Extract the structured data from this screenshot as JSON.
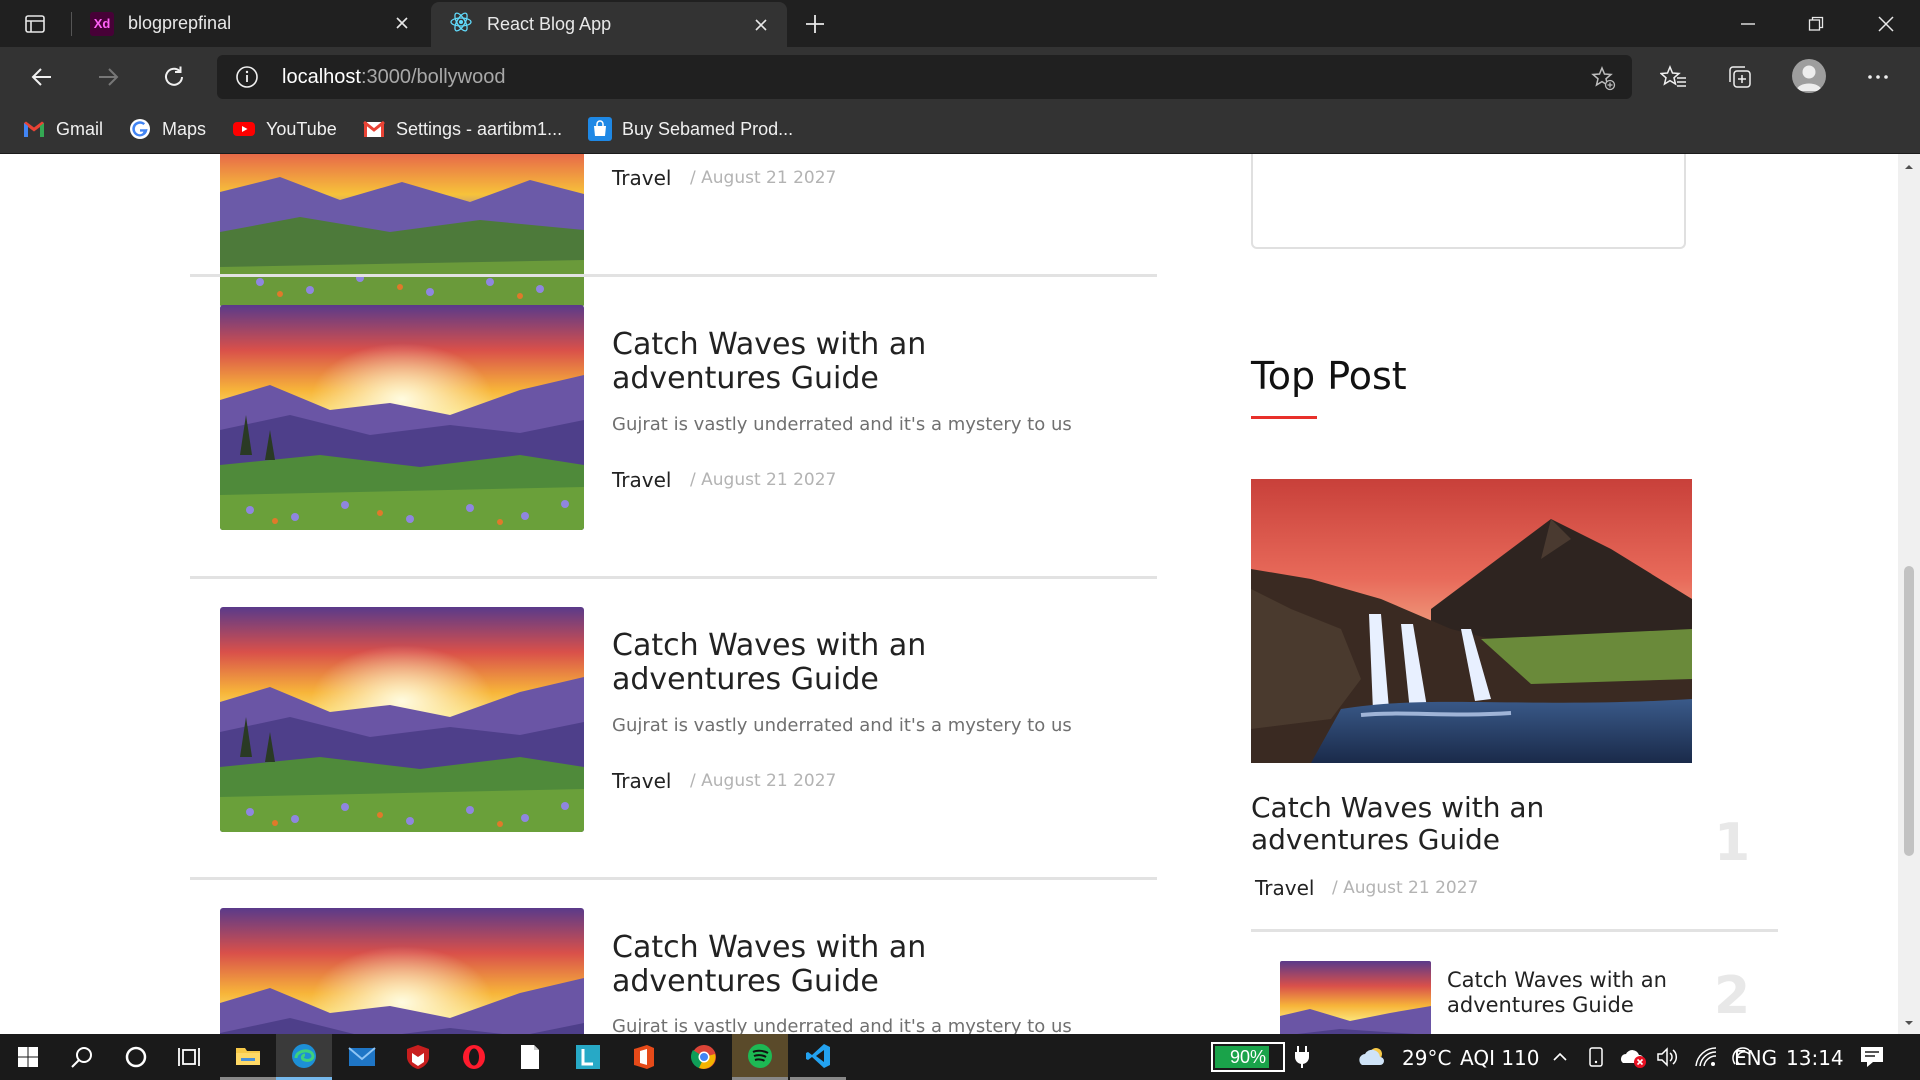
{
  "browser": {
    "tabs": [
      {
        "title": "blogprepfinal",
        "icon": "adobe-xd-icon"
      },
      {
        "title": "React Blog App",
        "icon": "react-icon",
        "active": true
      }
    ],
    "address": {
      "host": "localhost",
      "path": ":3000/bollywood"
    },
    "bookmarks": [
      {
        "label": "Gmail",
        "icon": "gmail-icon"
      },
      {
        "label": "Maps",
        "icon": "google-icon"
      },
      {
        "label": "YouTube",
        "icon": "youtube-icon"
      },
      {
        "label": "Settings - aartibm1...",
        "icon": "gmail-icon"
      },
      {
        "label": "Buy Sebamed Prod...",
        "icon": "shop-icon"
      }
    ]
  },
  "posts": [
    {
      "title": "",
      "desc": "",
      "category": "Travel",
      "date": "/ August 21 2027"
    },
    {
      "title": "Catch Waves with an adventures Guide",
      "desc": "Gujrat is vastly underrated and it's a mystery to us",
      "category": "Travel",
      "date": "/ August 21 2027"
    },
    {
      "title": "Catch Waves with an adventures Guide",
      "desc": "Gujrat is vastly underrated and it's a mystery to us",
      "category": "Travel",
      "date": "/ August 21 2027"
    },
    {
      "title": "Catch Waves with an adventures Guide",
      "desc": "Gujrat is vastly underrated and it's a mystery to us",
      "category": "",
      "date": ""
    }
  ],
  "sidebar": {
    "heading": "Top Post",
    "top_posts": [
      {
        "rank": "1",
        "title": "Catch Waves with an adventures Guide",
        "category": "Travel",
        "date": "/ August 21 2027"
      },
      {
        "rank": "2",
        "title": "Catch Waves with an adventures Guide"
      }
    ]
  },
  "taskbar": {
    "battery": "90%",
    "battery_level": 0.9,
    "weather": "29°C",
    "aqi": "AQI 110",
    "language": "ENG",
    "time": "13:14"
  },
  "colors": {
    "accent": "#e8302a",
    "tab_active": "#333333",
    "chrome_dark": "#202020"
  }
}
